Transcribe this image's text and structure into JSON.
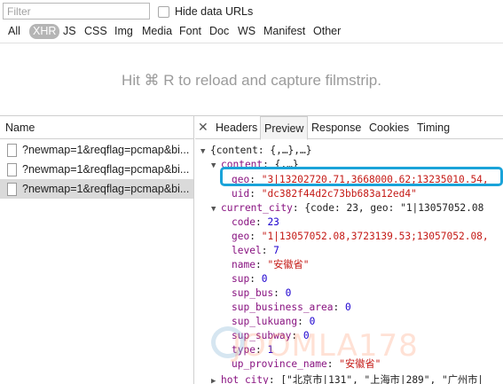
{
  "filter": {
    "placeholder": "Filter",
    "hide_label": "Hide data URLs"
  },
  "types": [
    "All",
    "XHR",
    "JS",
    "CSS",
    "Img",
    "Media",
    "Font",
    "Doc",
    "WS",
    "Manifest",
    "Other"
  ],
  "active_type": "XHR",
  "filmstrip_msg": "Hit ⌘ R to reload and capture filmstrip.",
  "requests": {
    "header": "Name",
    "items": [
      "?newmap=1&reqflag=pcmap&bi...",
      "?newmap=1&reqflag=pcmap&bi...",
      "?newmap=1&reqflag=pcmap&bi..."
    ]
  },
  "tabs": [
    "Headers",
    "Preview",
    "Response",
    "Cookies",
    "Timing"
  ],
  "active_tab": "Preview",
  "preview": {
    "root": "{content: {,…},…}",
    "content_key": "content",
    "content_val": "{,…}",
    "geo_key": "geo",
    "geo_val": "\"3|13202720.71,3668000.62;13235010.54,",
    "uid_key": "uid",
    "uid_val": "\"dc382f44d2c73bb683a12ed4\"",
    "current_city_key": "current_city",
    "current_city_val": "{code: 23, geo: \"1|13057052.08",
    "code_key": "code",
    "code_val": "23",
    "geo2_key": "geo",
    "geo2_val": "\"1|13057052.08,3723139.53;13057052.08,",
    "level_key": "level",
    "level_val": "7",
    "name_key": "name",
    "name_val": "\"安徽省\"",
    "sup_key": "sup",
    "sup_val": "0",
    "sup_bus_key": "sup_bus",
    "sup_bus_val": "0",
    "sup_business_area_key": "sup_business_area",
    "sup_business_area_val": "0",
    "sup_lukuang_key": "sup_lukuang",
    "sup_lukuang_val": "0",
    "sup_subway_key": "sup_subway",
    "sup_subway_val": "0",
    "type_key": "type",
    "type_val": "1",
    "up_province_name_key": "up_province_name",
    "up_province_name_val": "\"安徽省\"",
    "hot_city_key": "hot_city",
    "hot_city_val": "[\"北京市|131\", \"上海市|289\", \"广州市|"
  },
  "watermark": "JOOMLA178",
  "colors": {
    "highlight": "#1aa3d9",
    "key": "#881280",
    "string": "#c41a16",
    "number": "#1c00cf"
  }
}
